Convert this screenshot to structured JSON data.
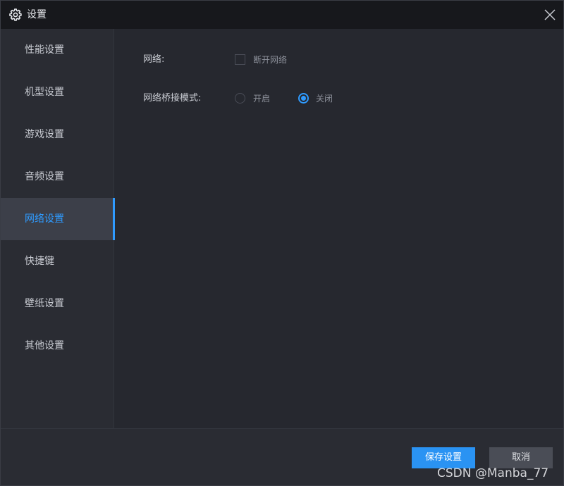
{
  "window": {
    "title": "设置"
  },
  "sidebar": {
    "items": [
      {
        "label": "性能设置",
        "active": false
      },
      {
        "label": "机型设置",
        "active": false
      },
      {
        "label": "游戏设置",
        "active": false
      },
      {
        "label": "音频设置",
        "active": false
      },
      {
        "label": "网络设置",
        "active": true
      },
      {
        "label": "快捷键",
        "active": false
      },
      {
        "label": "壁纸设置",
        "active": false
      },
      {
        "label": "其他设置",
        "active": false
      }
    ]
  },
  "network": {
    "label": "网络:",
    "disconnect_label": "断开网络",
    "disconnect_checked": false
  },
  "bridge": {
    "label": "网络桥接模式:",
    "options": [
      {
        "label": "开启",
        "checked": false
      },
      {
        "label": "关闭",
        "checked": true
      }
    ]
  },
  "footer": {
    "save_label": "保存设置",
    "cancel_label": "取消",
    "watermark": "CSDN @Manba_77"
  },
  "colors": {
    "accent": "#2f9bff",
    "titlebar": "#17181c",
    "sidebar": "#2a2c33",
    "content": "#26282f"
  },
  "icons": {
    "title": "gear-icon",
    "close": "close-icon"
  }
}
